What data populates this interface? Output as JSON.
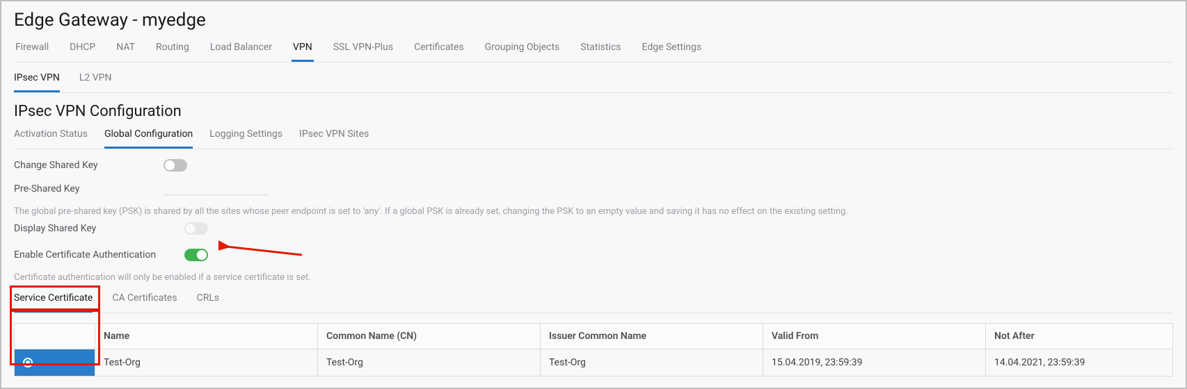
{
  "page_title": "Edge Gateway - myedge",
  "main_tabs": [
    "Firewall",
    "DHCP",
    "NAT",
    "Routing",
    "Load Balancer",
    "VPN",
    "SSL VPN-Plus",
    "Certificates",
    "Grouping Objects",
    "Statistics",
    "Edge Settings"
  ],
  "main_tabs_active_index": 5,
  "sub_tabs": [
    "IPsec VPN",
    "L2 VPN"
  ],
  "sub_tabs_active_index": 0,
  "section_title": "IPsec VPN Configuration",
  "config_tabs": [
    "Activation Status",
    "Global Configuration",
    "Logging Settings",
    "IPsec VPN Sites"
  ],
  "config_tabs_active_index": 1,
  "form": {
    "change_shared_key_label": "Change Shared Key",
    "change_shared_key_on": false,
    "pre_shared_key_label": "Pre-Shared Key",
    "pre_shared_key_value": "",
    "psk_help": "The global pre-shared key (PSK) is shared by all the sites whose peer endpoint is set to 'any'. If a global PSK is already set, changing the PSK to an empty value and saving it has no effect on the existing setting.",
    "display_shared_key_label": "Display Shared Key",
    "display_shared_key_enabled": false,
    "enable_cert_auth_label": "Enable Certificate Authentication",
    "enable_cert_auth_on": true,
    "cert_auth_help": "Certificate authentication will only be enabled if a service certificate is set."
  },
  "cert_tabs": [
    "Service Certificate",
    "CA Certificates",
    "CRLs"
  ],
  "cert_tabs_active_index": 0,
  "cert_table": {
    "headers": [
      "",
      "Name",
      "Common Name (CN)",
      "Issuer Common Name",
      "Valid From",
      "Not After"
    ],
    "rows": [
      {
        "selected": true,
        "name": "Test-Org",
        "cn": "Test-Org",
        "issuer": "Test-Org",
        "valid_from": "15.04.2019, 23:59:39",
        "not_after": "14.04.2021, 23:59:39"
      }
    ]
  }
}
